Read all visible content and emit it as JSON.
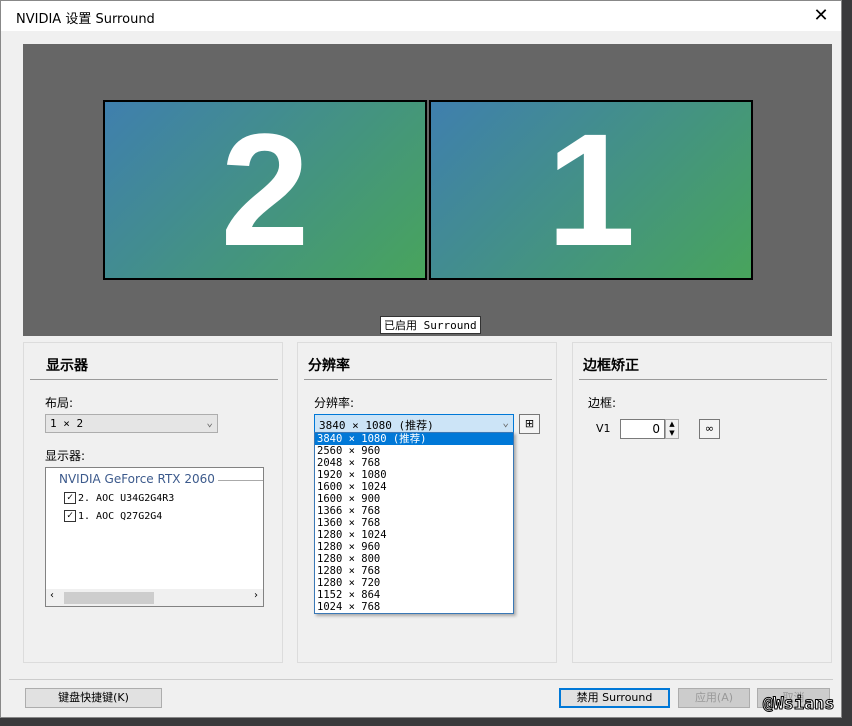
{
  "window": {
    "title": "NVIDIA 设置 Surround",
    "close": "✕"
  },
  "preview": {
    "monitors": [
      "2",
      "1"
    ],
    "status": "已启用 Surround"
  },
  "displays_panel": {
    "heading": "显示器",
    "layout_label": "布局:",
    "layout_value": "1 × 2",
    "displays_label": "显示器:",
    "gpu": "NVIDIA GeForce RTX 2060",
    "items": [
      {
        "label": "2. AOC U34G2G4R3",
        "checked": true
      },
      {
        "label": "1. AOC Q27G2G4",
        "checked": true
      }
    ]
  },
  "resolution_panel": {
    "heading": "分辨率",
    "label": "分辨率:",
    "value": "3840 × 1080 (推荐)",
    "options": [
      "3840 × 1080 (推荐)",
      "2560 × 960",
      "2048 × 768",
      "1920 × 1080",
      "1600 × 1024",
      "1600 × 900",
      "1366 × 768",
      "1360 × 768",
      "1280 × 1024",
      "1280 × 960",
      "1280 × 800",
      "1280 × 768",
      "1280 × 720",
      "1152 × 864",
      "1024 × 768"
    ]
  },
  "bezel_panel": {
    "heading": "边框矫正",
    "label": "边框:",
    "v1_label": "V1",
    "v1_value": "0"
  },
  "buttons": {
    "keyboard": "键盘快捷键(K)",
    "disable": "禁用 Surround",
    "apply": "应用(A)",
    "cancel": "取消"
  },
  "watermark": "@Wsians"
}
